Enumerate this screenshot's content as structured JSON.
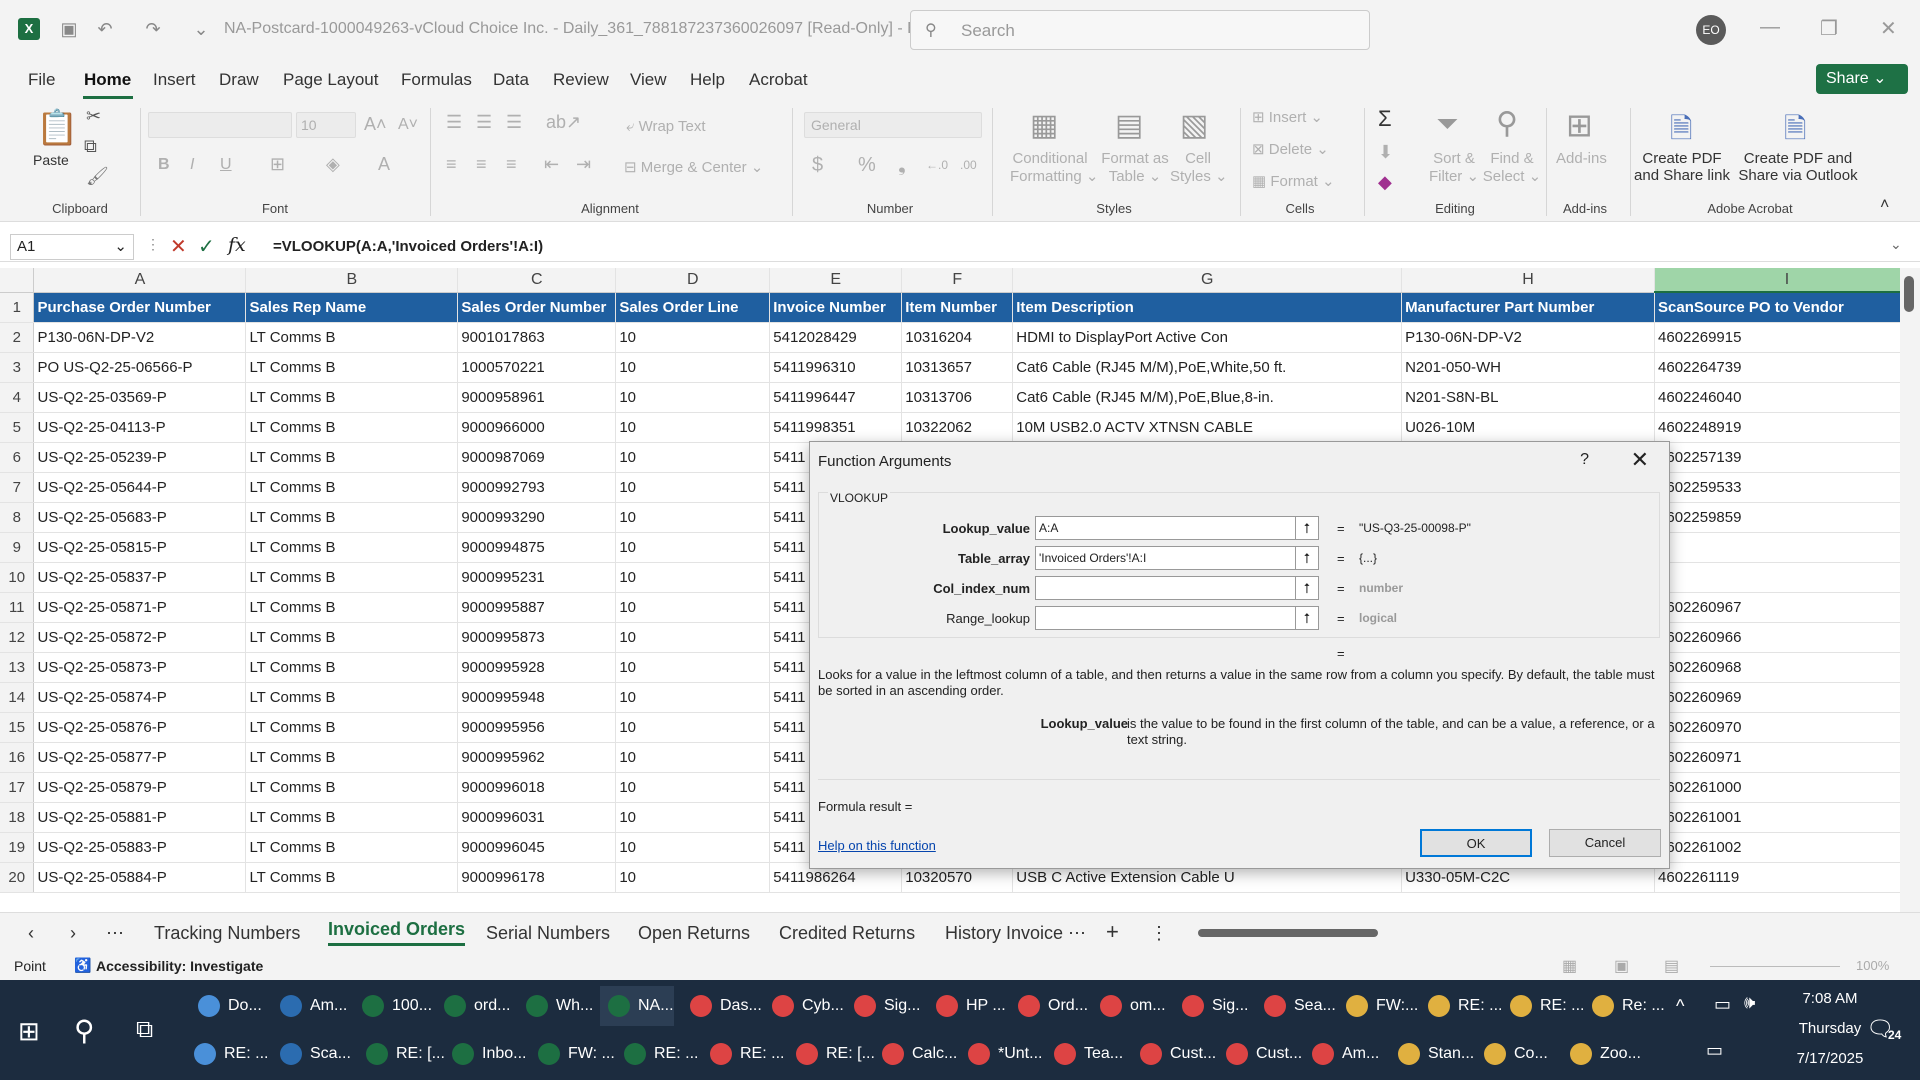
{
  "titlebar": {
    "doc_title": "NA-Postcard-1000049263-vCloud Choice Inc. - Daily_361_788187237360026097  [Read-Only]  -  E...",
    "search_placeholder": "Search",
    "avatar": "EO"
  },
  "menu": [
    "File",
    "Home",
    "Insert",
    "Draw",
    "Page Layout",
    "Formulas",
    "Data",
    "Review",
    "View",
    "Help",
    "Acrobat"
  ],
  "share_label": "Share",
  "ribbon": {
    "clipboard": {
      "paste": "Paste",
      "label": "Clipboard"
    },
    "font": {
      "size": "10",
      "label": "Font"
    },
    "alignment": {
      "wrap": "Wrap Text",
      "merge": "Merge & Center",
      "label": "Alignment"
    },
    "number": {
      "format": "General",
      "label": "Number"
    },
    "styles": {
      "cond1": "Conditional",
      "cond2": "Formatting",
      "fmt1": "Format as",
      "fmt2": "Table",
      "cell1": "Cell",
      "cell2": "Styles",
      "label": "Styles"
    },
    "cells": {
      "insert": "Insert",
      "delete": "Delete",
      "format": "Format",
      "label": "Cells"
    },
    "editing": {
      "sort1": "Sort &",
      "sort2": "Filter",
      "find1": "Find &",
      "find2": "Select",
      "label": "Editing"
    },
    "addins": {
      "addins": "Add-ins",
      "label": "Add-ins"
    },
    "acrobat": {
      "c1a": "Create PDF",
      "c1b": "and Share link",
      "c2a": "Create PDF and",
      "c2b": "Share via Outlook",
      "label": "Adobe Acrobat"
    }
  },
  "formula_bar": {
    "namebox": "A1",
    "fx": "fx",
    "formula": "=VLOOKUP(A:A,'Invoiced Orders'!A:I)"
  },
  "grid": {
    "columns": [
      "A",
      "B",
      "C",
      "D",
      "E",
      "F",
      "G",
      "H",
      "I"
    ],
    "header_row": [
      "Purchase Order Number",
      "Sales Rep Name",
      "Sales Order Number",
      "Sales Order Line",
      "Invoice Number",
      "Item Number",
      "Item Description",
      "Manufacturer Part Number",
      "ScanSource PO to Vendor"
    ],
    "rows": [
      [
        "2",
        "P130-06N-DP-V2",
        "LT Comms B",
        "9001017863",
        "10",
        "5412028429",
        "10316204",
        "HDMI to DisplayPort Active Con",
        "P130-06N-DP-V2",
        "4602269915"
      ],
      [
        "3",
        "PO US-Q2-25-06566-P",
        "LT Comms B",
        "1000570221",
        "10",
        "5411996310",
        "10313657",
        "Cat6 Cable (RJ45 M/M),PoE,White,50 ft.",
        "N201-050-WH",
        "4602264739"
      ],
      [
        "4",
        "US-Q2-25-03569-P",
        "LT Comms B",
        "9000958961",
        "10",
        "5411996447",
        "10313706",
        "Cat6 Cable (RJ45 M/M),PoE,Blue,8-in.",
        "N201-S8N-BL",
        "4602246040"
      ],
      [
        "5",
        "US-Q2-25-04113-P",
        "LT Comms B",
        "9000966000",
        "10",
        "5411998351",
        "10322062",
        "10M USB2.0 ACTV XTNSN CABLE",
        "U026-10M",
        "4602248919"
      ],
      [
        "6",
        "US-Q2-25-05239-P",
        "LT Comms B",
        "9000987069",
        "10",
        "5411",
        "",
        "",
        "",
        "4602257139"
      ],
      [
        "7",
        "US-Q2-25-05644-P",
        "LT Comms B",
        "9000992793",
        "10",
        "5411",
        "",
        "",
        "",
        "4602259533"
      ],
      [
        "8",
        "US-Q2-25-05683-P",
        "LT Comms B",
        "9000993290",
        "10",
        "5411",
        "",
        "",
        "",
        "4602259859"
      ],
      [
        "9",
        "US-Q2-25-05815-P",
        "LT Comms B",
        "9000994875",
        "10",
        "5411",
        "",
        "",
        "",
        ""
      ],
      [
        "10",
        "US-Q2-25-05837-P",
        "LT Comms B",
        "9000995231",
        "10",
        "5411",
        "",
        "",
        "",
        ""
      ],
      [
        "11",
        "US-Q2-25-05871-P",
        "LT Comms B",
        "9000995887",
        "10",
        "5411",
        "",
        "",
        "",
        "4602260967"
      ],
      [
        "12",
        "US-Q2-25-05872-P",
        "LT Comms B",
        "9000995873",
        "10",
        "5411",
        "",
        "",
        "",
        "4602260966"
      ],
      [
        "13",
        "US-Q2-25-05873-P",
        "LT Comms B",
        "9000995928",
        "10",
        "5411",
        "",
        "",
        "",
        "4602260968"
      ],
      [
        "14",
        "US-Q2-25-05874-P",
        "LT Comms B",
        "9000995948",
        "10",
        "5411",
        "",
        "",
        "",
        "4602260969"
      ],
      [
        "15",
        "US-Q2-25-05876-P",
        "LT Comms B",
        "9000995956",
        "10",
        "5411",
        "",
        "",
        "",
        "4602260970"
      ],
      [
        "16",
        "US-Q2-25-05877-P",
        "LT Comms B",
        "9000995962",
        "10",
        "5411",
        "",
        "",
        "",
        "4602260971"
      ],
      [
        "17",
        "US-Q2-25-05879-P",
        "LT Comms B",
        "9000996018",
        "10",
        "5411",
        "",
        "",
        "",
        "4602261000"
      ],
      [
        "18",
        "US-Q2-25-05881-P",
        "LT Comms B",
        "9000996031",
        "10",
        "5411",
        "",
        "",
        "",
        "4602261001"
      ],
      [
        "19",
        "US-Q2-25-05883-P",
        "LT Comms B",
        "9000996045",
        "10",
        "5411",
        "",
        "",
        "",
        "4602261002"
      ],
      [
        "20",
        "US-Q2-25-05884-P",
        "LT Comms B",
        "9000996178",
        "10",
        "5411986264",
        "10320570",
        "USB C Active Extension Cable U",
        "U330-05M-C2C",
        "4602261119"
      ]
    ]
  },
  "dialog": {
    "title": "Function Arguments",
    "help": "?",
    "close": "✕",
    "function": "VLOOKUP",
    "args": [
      {
        "label": "Lookup_value",
        "value": "A:A",
        "result": "\"US-Q3-25-00098-P\"",
        "bold": true
      },
      {
        "label": "Table_array",
        "value": "'Invoiced Orders'!A:I",
        "result": "{...}",
        "bold": true
      },
      {
        "label": "Col_index_num",
        "value": "",
        "result": "number",
        "bold": true
      },
      {
        "label": "Range_lookup",
        "value": "",
        "result": "logical",
        "bold": false
      }
    ],
    "eq": "=",
    "description": "Looks for a value in the leftmost column of a table, and then returns a value in the same row from a column you specify. By default, the table must be sorted in an ascending order.",
    "arg_name": "Lookup_value",
    "arg_desc": "is the value to be found in the first column of the table, and can be a value, a reference, or a text string.",
    "formula_result": "Formula result =",
    "help_link": "Help on this function",
    "ok": "OK",
    "cancel": "Cancel"
  },
  "sheet_tabs": [
    "Tracking Numbers",
    "Invoiced Orders",
    "Serial Numbers",
    "Open Returns",
    "Credited Returns",
    "History Invoice"
  ],
  "status": {
    "mode": "Point",
    "accessibility": "Accessibility: Investigate",
    "zoom": "100%"
  },
  "taskbar": {
    "row1": [
      "Do...",
      "Am...",
      "100...",
      "ord...",
      "Wh...",
      "NA...",
      "Das...",
      "Cyb...",
      "Sig...",
      "HP ...",
      "Ord...",
      "om...",
      "Sig...",
      "Sea...",
      "FW:...",
      "RE: ...",
      "RE: ...",
      "Re: ..."
    ],
    "row2": [
      "RE: ...",
      "Sca...",
      "RE: [...",
      "Inbo...",
      "FW: ...",
      "RE: ...",
      "RE: ...",
      "RE: [...",
      "Calc...",
      "*Unt...",
      "Tea...",
      "Cust...",
      "Cust...",
      "Am...",
      "Stan...",
      "Co...",
      "Zoo..."
    ],
    "time": "7:08 AM",
    "day": "Thursday",
    "date": "7/17/2025",
    "notif": "24"
  }
}
